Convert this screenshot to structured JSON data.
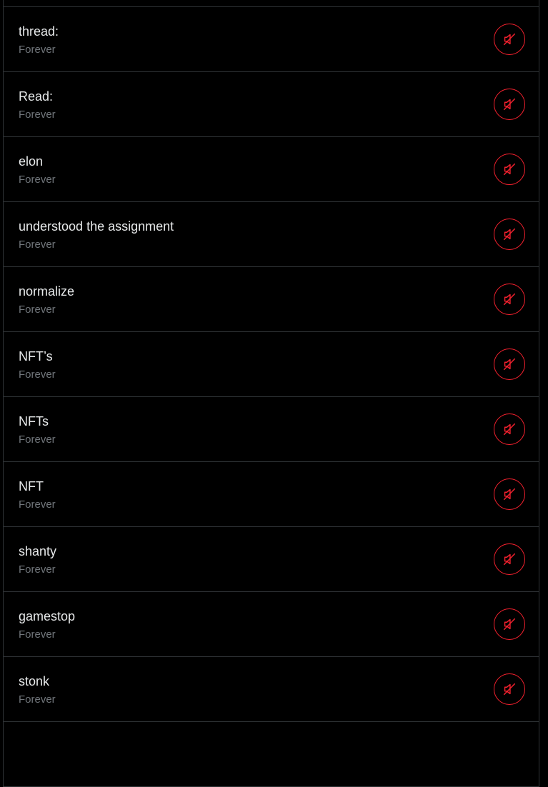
{
  "accent_color": "#f4212e",
  "muted_words": {
    "items": [
      {
        "word": "",
        "duration": ""
      },
      {
        "word": "thread:",
        "duration": "Forever",
        "action_icon": "speaker-muted-icon"
      },
      {
        "word": "Read:",
        "duration": "Forever",
        "action_icon": "speaker-muted-icon"
      },
      {
        "word": "elon",
        "duration": "Forever",
        "action_icon": "speaker-muted-icon"
      },
      {
        "word": "understood the assignment",
        "duration": "Forever",
        "action_icon": "speaker-muted-icon"
      },
      {
        "word": "normalize",
        "duration": "Forever",
        "action_icon": "speaker-muted-icon"
      },
      {
        "word": "NFT’s",
        "duration": "Forever",
        "action_icon": "speaker-muted-icon"
      },
      {
        "word": "NFTs",
        "duration": "Forever",
        "action_icon": "speaker-muted-icon"
      },
      {
        "word": "NFT",
        "duration": "Forever",
        "action_icon": "speaker-muted-icon"
      },
      {
        "word": "shanty",
        "duration": "Forever",
        "action_icon": "speaker-muted-icon"
      },
      {
        "word": "gamestop",
        "duration": "Forever",
        "action_icon": "speaker-muted-icon"
      },
      {
        "word": "stonk",
        "duration": "Forever",
        "action_icon": "speaker-muted-icon"
      },
      {
        "word": "",
        "duration": ""
      }
    ]
  }
}
